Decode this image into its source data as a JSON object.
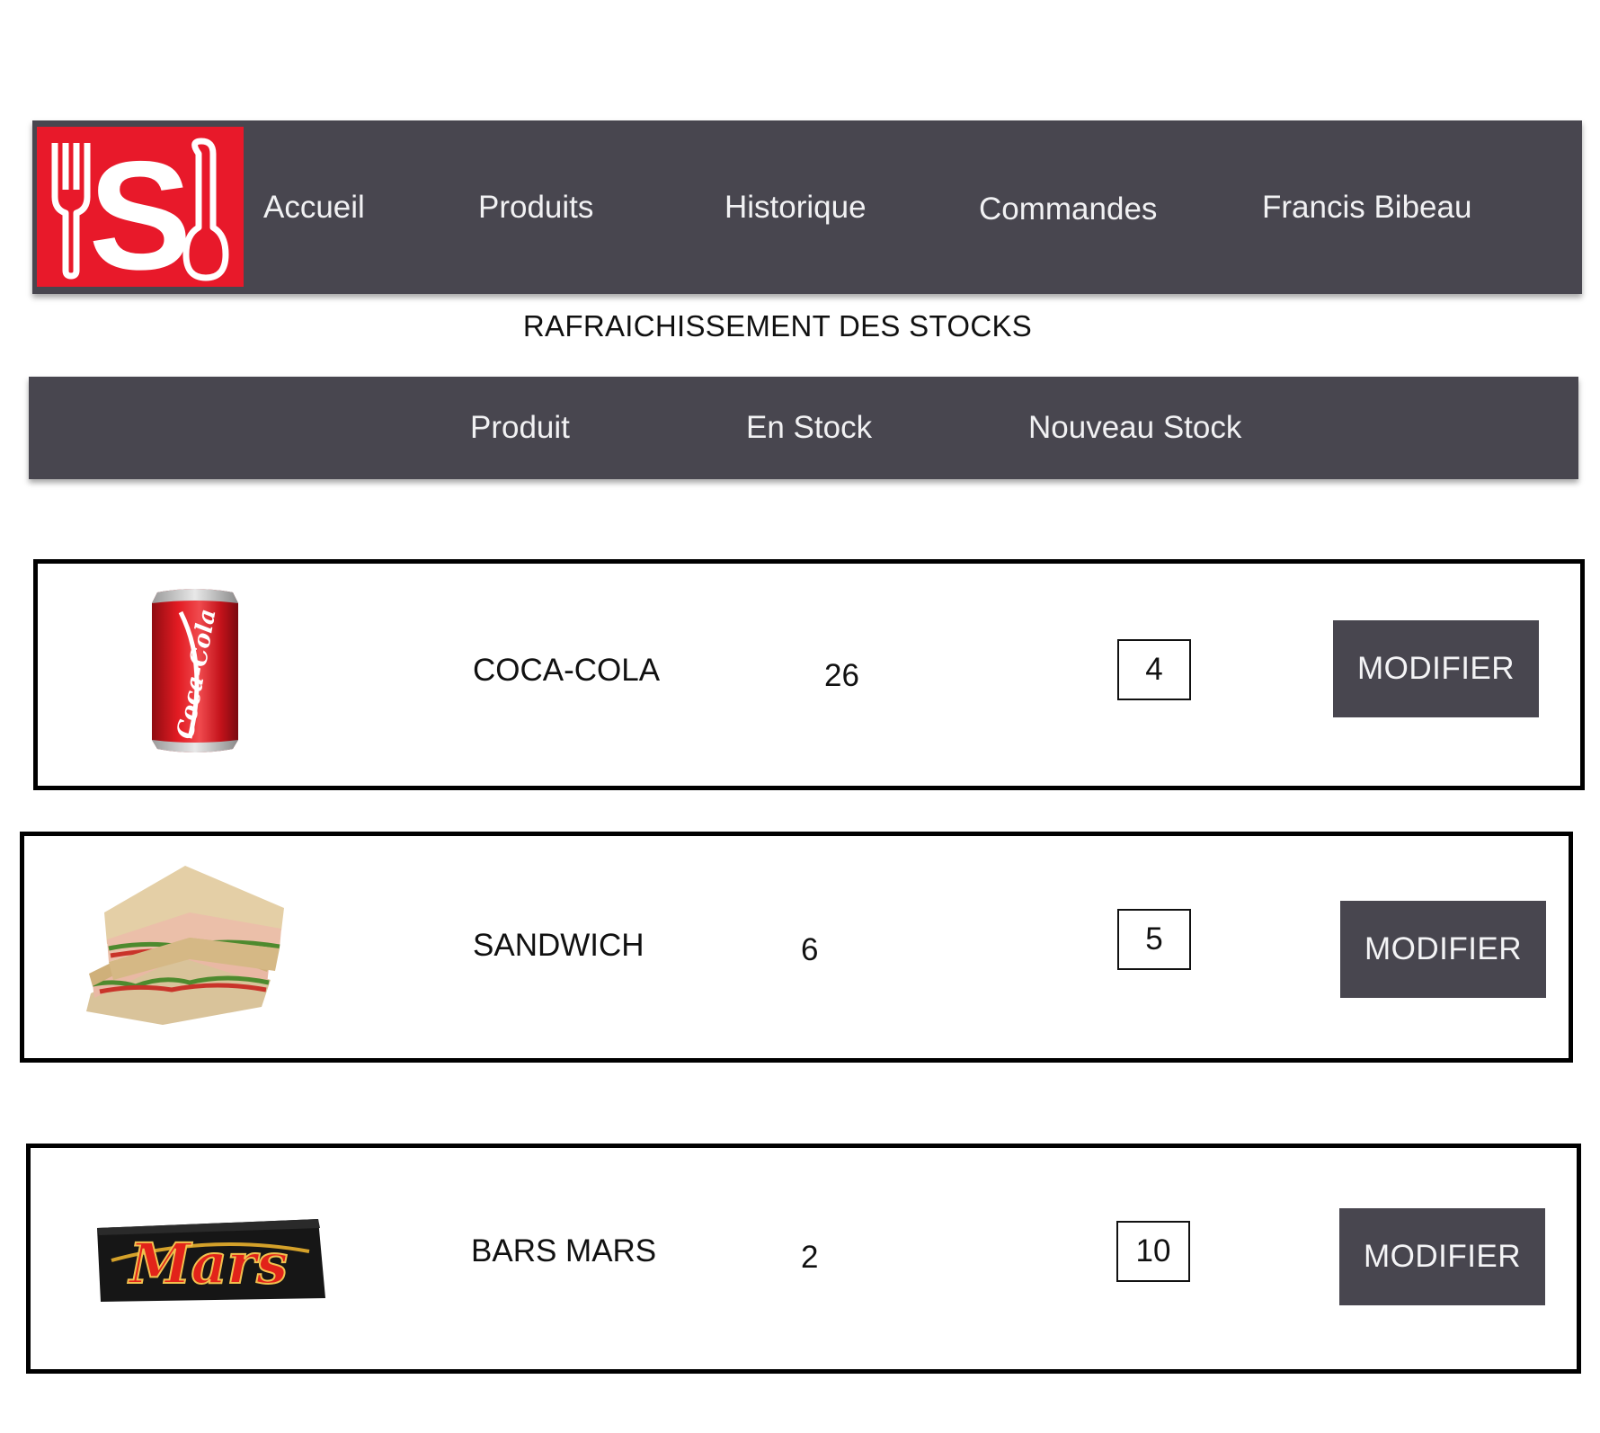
{
  "colors": {
    "nav_background": "#48464f",
    "logo_background": "#e8192a",
    "button_background": "#48464f"
  },
  "nav": {
    "logo_icon": "fork-s-spoon-logo",
    "items": [
      "Accueil",
      "Produits",
      "Historique",
      "Commandes",
      "Francis Bibeau"
    ]
  },
  "page_title": "RAFRAICHISSEMENT DES STOCKS",
  "table": {
    "headers": [
      "Produit",
      "En Stock",
      "Nouveau Stock"
    ],
    "rows": [
      {
        "image": "coca-cola-can",
        "product": "COCA-COLA",
        "in_stock": "26",
        "new_stock": "4",
        "button": "MODIFIER"
      },
      {
        "image": "sandwich",
        "product": "SANDWICH",
        "in_stock": "6",
        "new_stock": "5",
        "button": "MODIFIER"
      },
      {
        "image": "mars-bar",
        "product": "BARS MARS",
        "in_stock": "2",
        "new_stock": "10",
        "button": "MODIFIER"
      }
    ]
  }
}
